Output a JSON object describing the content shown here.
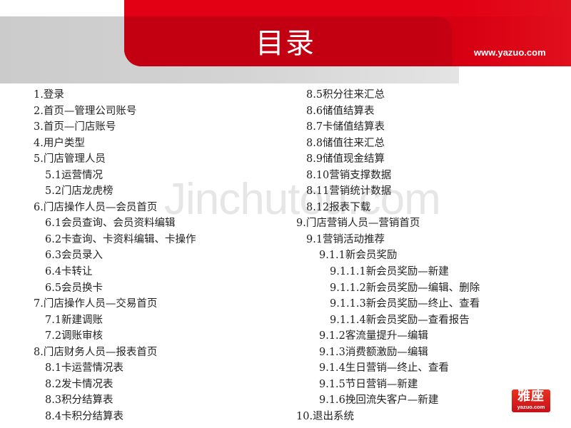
{
  "header": {
    "title": "目录",
    "site_url": "www.yazuo.com",
    "colors": {
      "red": "#e30014",
      "dark_red": "#c20012",
      "gray": "#d0d0d0"
    }
  },
  "watermark": "Jinchutou.com",
  "toc_left": [
    {
      "level": 1,
      "text": "1.登录"
    },
    {
      "level": 1,
      "text": "2.首页—管理公司账号"
    },
    {
      "level": 1,
      "text": "3.首页—门店账号"
    },
    {
      "level": 1,
      "text": "4.用户类型"
    },
    {
      "level": 1,
      "text": "5.门店管理人员"
    },
    {
      "level": 2,
      "text": "5.1运营情况"
    },
    {
      "level": 2,
      "text": "5.2门店龙虎榜"
    },
    {
      "level": 1,
      "text": "6.门店操作人员—会员首页"
    },
    {
      "level": 2,
      "text": "6.1会员查询、会员资料编辑"
    },
    {
      "level": 2,
      "text": "6.2卡查询、卡资料编辑、卡操作"
    },
    {
      "level": 2,
      "text": "6.3会员录入"
    },
    {
      "level": 2,
      "text": "6.4卡转让"
    },
    {
      "level": 2,
      "text": "6.5会员换卡"
    },
    {
      "level": 1,
      "text": "7.门店操作人员—交易首页"
    },
    {
      "level": 2,
      "text": "7.1新建调账"
    },
    {
      "level": 2,
      "text": "7.2调账审核"
    },
    {
      "level": 1,
      "text": "8.门店财务人员—报表首页"
    },
    {
      "level": 2,
      "text": "8.1卡运营情况表"
    },
    {
      "level": 2,
      "text": "8.2发卡情况表"
    },
    {
      "level": 2,
      "text": "8.3积分结算表"
    },
    {
      "level": 2,
      "text": "8.4卡积分结算表"
    }
  ],
  "toc_right": [
    {
      "level": 2,
      "text": "8.5积分往来汇总"
    },
    {
      "level": 2,
      "text": "8.6储值结算表"
    },
    {
      "level": 2,
      "text": "8.7卡储值结算表"
    },
    {
      "level": 2,
      "text": "8.8储值往来汇总"
    },
    {
      "level": 2,
      "text": "8.9储值现金结算"
    },
    {
      "level": 2,
      "text": "8.10营销支撑数据"
    },
    {
      "level": 2,
      "text": "8.11营销统计数据"
    },
    {
      "level": 2,
      "text": "8.12报表下载"
    },
    {
      "level": 1,
      "text": "9.门店营销人员—营销首页"
    },
    {
      "level": 2,
      "text": "9.1营销活动推荐"
    },
    {
      "level": 3,
      "text": "9.1.1新会员奖励"
    },
    {
      "level": 4,
      "text": "9.1.1.1新会员奖励—新建"
    },
    {
      "level": 4,
      "text": "9.1.1.2新会员奖励—编辑、删除"
    },
    {
      "level": 4,
      "text": "9.1.1.3新会员奖励—终止、查看"
    },
    {
      "level": 4,
      "text": "9.1.1.4新会员奖励—查看报告"
    },
    {
      "level": 3,
      "text": "9.1.2客流量提升—编辑"
    },
    {
      "level": 3,
      "text": "9.1.3消费额激励—编辑"
    },
    {
      "level": 3,
      "text": "9.1.4生日营销—终止、查看"
    },
    {
      "level": 3,
      "text": "9.1.5节日营销—新建"
    },
    {
      "level": 3,
      "text": "9.1.6挽回流失客户—新建"
    },
    {
      "level": 1,
      "text": "10.退出系统"
    }
  ],
  "logo": {
    "name_cn": "雅座",
    "name_en": "yazuo.com"
  }
}
